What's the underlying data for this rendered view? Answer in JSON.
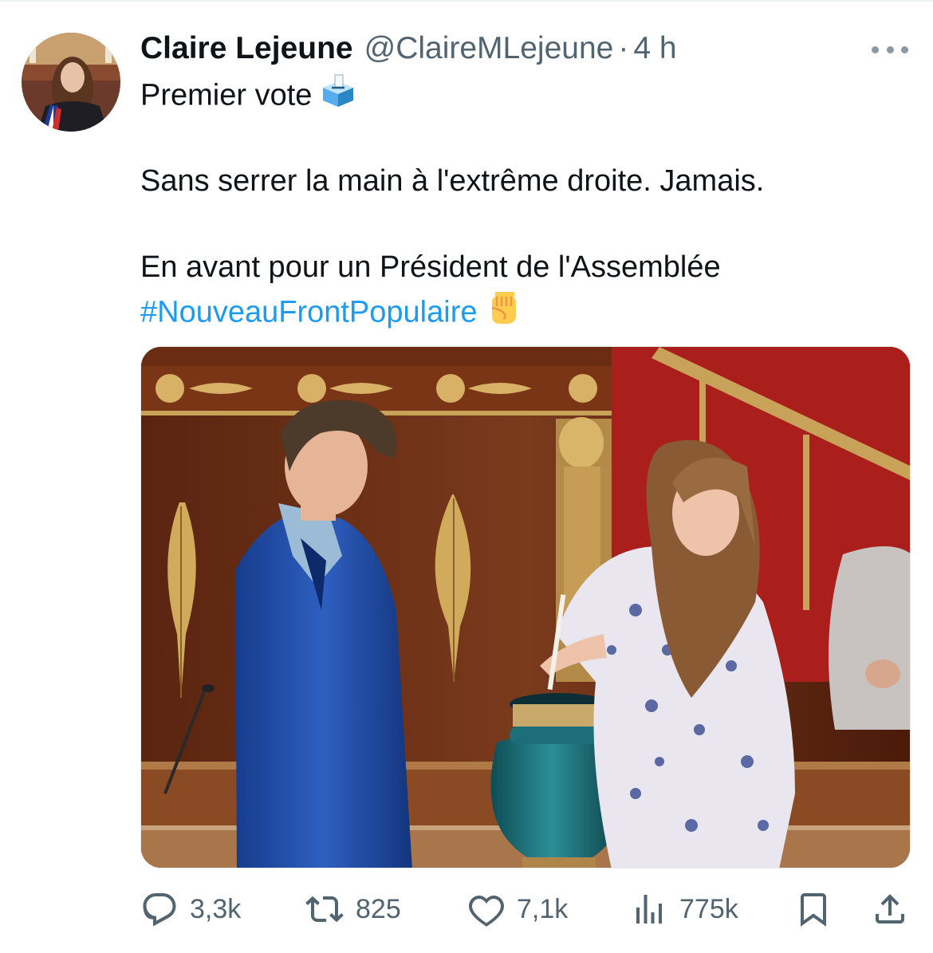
{
  "tweet": {
    "author": {
      "display_name": "Claire Lejeune",
      "handle": "@ClaireMLejeune",
      "separator": "·",
      "time": "4 h",
      "avatar_icon": "avatar-photo"
    },
    "text_lines": [
      "Premier vote",
      "Sans serrer la main à l'extrême droite. Jamais.",
      "En avant pour un Président de l'Assemblée"
    ],
    "hashtag": "#NouveauFrontPopulaire",
    "emojis": [
      "ballot-box-icon",
      "raised-fist-icon"
    ],
    "more_icon": "more-dots-icon",
    "media_icon": "photo-vote-assemblee",
    "actions": {
      "replies": "3,3k",
      "reposts": "825",
      "likes": "7,1k",
      "views": "775k"
    }
  },
  "colors": {
    "text": "#0f1419",
    "secondary": "#536471",
    "link": "#1d9bf0"
  }
}
